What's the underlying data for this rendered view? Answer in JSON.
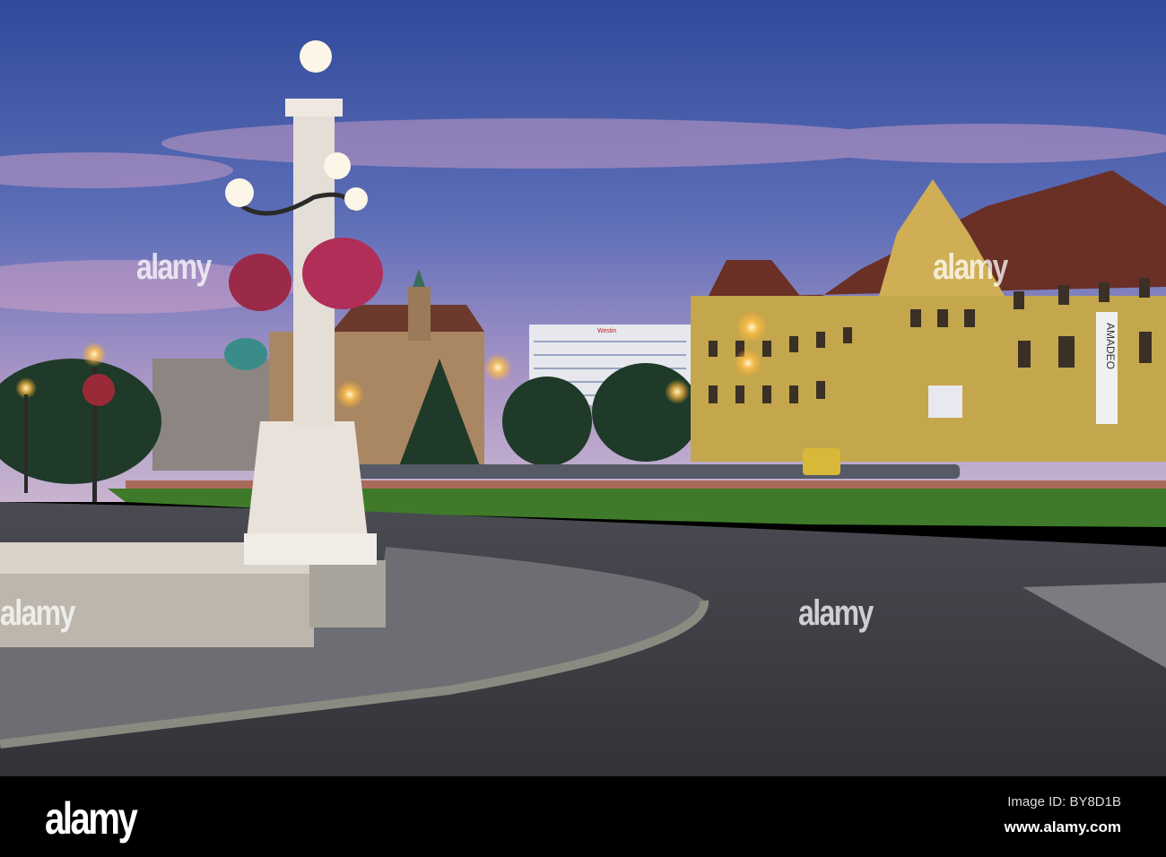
{
  "photo": {
    "subject": "Town square at dusk with lamp post and museum building",
    "signs": {
      "hotel": "Westin",
      "banner": "AMADEO"
    },
    "colors": {
      "sky_top": "#34509e",
      "sky_horizon": "#c9a6c8",
      "museum": "#c9aa4e",
      "road": "#3d3f45",
      "grass": "#3f7a2a"
    }
  },
  "watermark": {
    "text": "alamy"
  },
  "footer": {
    "logo": "alamy",
    "image_id": "Image ID: BY8D1B",
    "url": "www.alamy.com"
  }
}
